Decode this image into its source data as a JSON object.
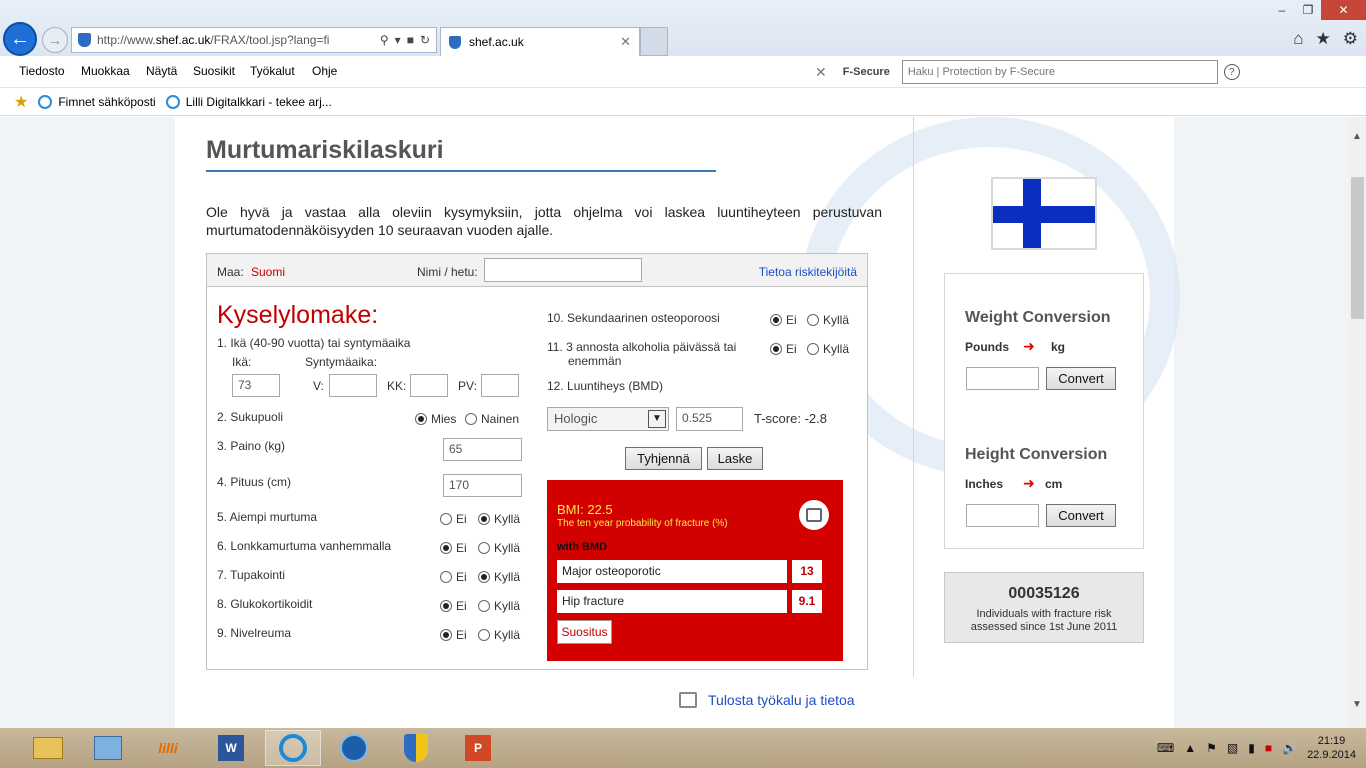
{
  "browser": {
    "url_prefix": "http://www.",
    "url_domain": "shef.ac.uk",
    "url_suffix": "/FRAX/tool.jsp?lang=fi",
    "tab_title": "shef.ac.uk",
    "menu": [
      "Tiedosto",
      "Muokkaa",
      "Näytä",
      "Suosikit",
      "Työkalut",
      "Ohje"
    ],
    "search_placeholder": "Haku | Protection by F-Secure",
    "fsecure_logo": "F-Secure",
    "favorites": [
      "Fimnet sähköposti",
      "Lilli Digitalkkari - tekee arj..."
    ]
  },
  "page": {
    "title": "Murtumariskilaskuri",
    "intro": "Ole hyvä ja vastaa alla oleviin kysymyksiin, jotta ohjelma voi laskea luuntiheyteen perustuvan murtumatodennäköisyyden 10 seuraavan vuoden ajalle.",
    "country_label": "Maa:",
    "country": "Suomi",
    "name_label": "Nimi / hetu:",
    "risk_link": "Tietoa riskitekijöitä",
    "form_title": "Kyselylomake:",
    "q1": "1. Ikä (40-90 vuotta) tai syntymäaika",
    "age_label": "Ikä:",
    "dob_label": "Syntymäaika:",
    "age_value": "73",
    "v_label": "V:",
    "kk_label": "KK:",
    "pv_label": "PV:",
    "q2": "2. Sukupuoli",
    "male": "Mies",
    "female": "Nainen",
    "q3": "3. Paino (kg)",
    "weight": "65",
    "q4": "4. Pituus (cm)",
    "height": "170",
    "q5": "5. Aiempi murtuma",
    "q6": "6. Lonkkamurtuma vanhemmalla",
    "q7": "7. Tupakointi",
    "q8": "8. Glukokortikoidit",
    "q9": "9. Nivelreuma",
    "q10": "10. Sekundaarinen osteoporoosi",
    "q11a": "11. 3 annosta alkoholia päivässä tai",
    "q11b": "enemmän",
    "q12": "12. Luuntiheys (BMD)",
    "no": "Ei",
    "yes": "Kyllä",
    "bmd_device": "Hologic",
    "bmd_value": "0.525",
    "tscore": "T-score: -2.8",
    "clear_btn": "Tyhjennä",
    "calc_btn": "Laske",
    "bmi": "BMI: 22.5",
    "prob_text": "The ten year probability of fracture (%)",
    "with_bmd": "with BMD",
    "major_label": "Major osteoporotic",
    "major_value": "13",
    "hip_label": "Hip fracture",
    "hip_value": "9.1",
    "suositus": "Suositus",
    "print_link": "Tulosta työkalu ja tietoa"
  },
  "sidebar": {
    "weight_title": "Weight Conversion",
    "pounds": "Pounds",
    "kg": "kg",
    "height_title": "Height Conversion",
    "inches": "Inches",
    "cm": "cm",
    "convert": "Convert",
    "counter": "00035126",
    "counter_desc1": "Individuals with fracture risk",
    "counter_desc2": "assessed since 1st June 2011"
  },
  "taskbar": {
    "time": "21:19",
    "date": "22.9.2014"
  },
  "colors": {
    "accent_red": "#d30000",
    "flag_blue": "#0a2fbe",
    "link_blue": "#1b4fc4"
  }
}
